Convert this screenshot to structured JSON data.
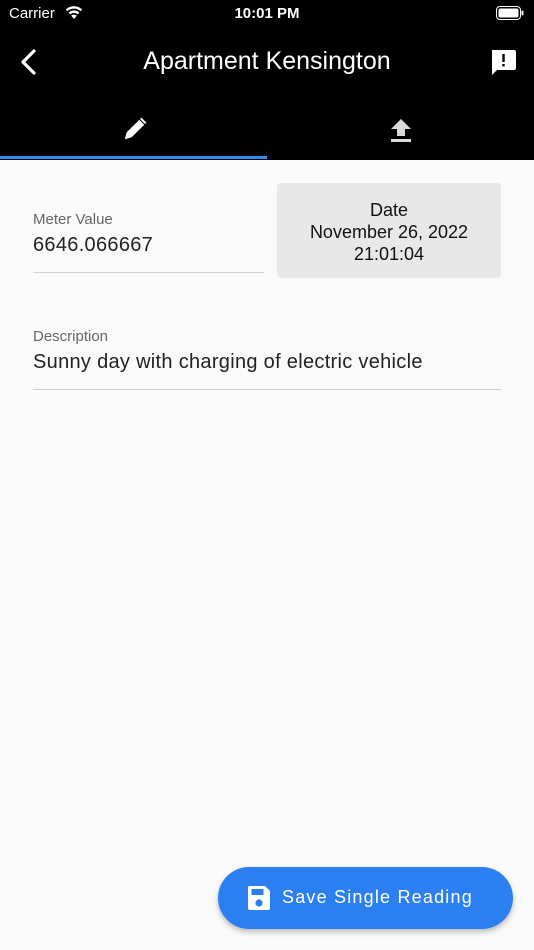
{
  "status_bar": {
    "carrier": "Carrier",
    "time": "10:01 PM"
  },
  "app_bar": {
    "title": "Apartment Kensington"
  },
  "tabs": [
    {
      "icon": "pencil-icon",
      "selected": true
    },
    {
      "icon": "upload-icon",
      "selected": false
    }
  ],
  "form": {
    "meter_value": {
      "label": "Meter Value",
      "value": "6646.066667"
    },
    "date": {
      "label": "Date",
      "date": "November 26, 2022",
      "time": "21:01:04"
    },
    "description": {
      "label": "Description",
      "value": "Sunny day with charging of electric vehicle"
    }
  },
  "fab": {
    "label": "Save Single Reading",
    "icon": "save-icon"
  },
  "colors": {
    "accent": "#2b7ff0",
    "tab_indicator": "#2f8cf0",
    "app_bar": "#000000"
  }
}
